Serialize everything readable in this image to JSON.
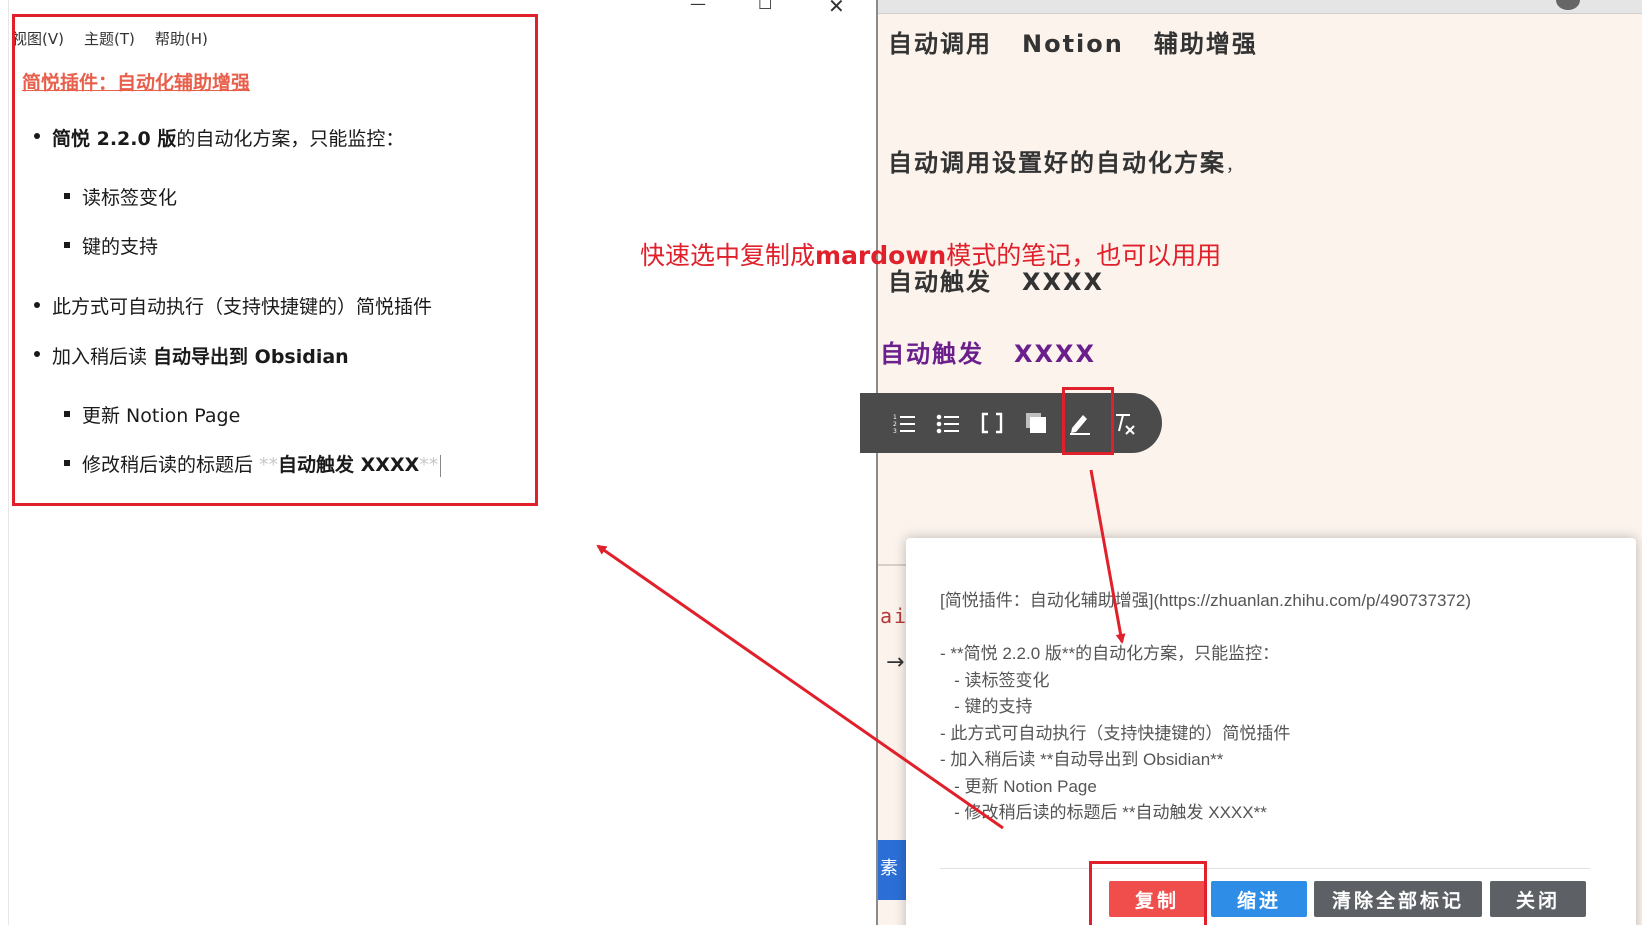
{
  "window": {
    "minimize_icon": "minimize-icon",
    "maximize_icon": "maximize-icon",
    "close_icon": "close-icon"
  },
  "menu": [
    "视图(V)",
    "主题(T)",
    "帮助(H)"
  ],
  "doc": {
    "title": "简悦插件：自动化辅助增强",
    "item1_bold": "简悦 2.2.0 版",
    "item1_rest": "的自动化方案，只能监控：",
    "sub1": "读标签变化",
    "sub2": "键的支持",
    "item2": "此方式可自动执行（支持快捷键的）简悦插件",
    "item3_pre": "加入稍后读 ",
    "item3_bold": "自动导出到 Obsidian",
    "sub3": "更新 Notion Page",
    "sub4_pre": "修改稍后读的标题后 ",
    "sub4_mark_open": "**",
    "sub4_bold": "自动触发 XXXX",
    "sub4_mark_close": "**"
  },
  "notion": {
    "h_auto_call": "自动调用",
    "h_notion": "Notion",
    "h_assist": "辅助增强",
    "h_preset": "自动调用设置好的自动化方案",
    "h_preset_comma": "，",
    "h_trigger_label": "自动触发",
    "h_trigger_value": "XXXX",
    "p_trigger_label": "自动触发",
    "p_trigger_value": "XXXX",
    "side_text": "ai.",
    "side_arrow": "→",
    "side_blue": "素"
  },
  "annotation": {
    "pre": "快速选中复制成",
    "bold": "mardown",
    "post": "模式的笔记，也可以用用"
  },
  "toolbar": {
    "icons": [
      "ordered-list-icon",
      "bullet-list-icon",
      "brackets-icon",
      "copy-icon",
      "highlight-pen-icon",
      "clear-format-icon"
    ]
  },
  "dialog": {
    "markdown": "[简悦插件：自动化辅助增强](https://zhuanlan.zhihu.com/p/490737372)\n\n- **简悦 2.2.0 版**的自动化方案，只能监控：\n   - 读标签变化\n   - 键的支持\n- 此方式可自动执行（支持快捷键的）简悦插件\n- 加入稍后读 **自动导出到 Obsidian**\n   - 更新 Notion Page\n   - 修改稍后读的标题后 **自动触发 XXXX**",
    "btn_copy": "复制",
    "btn_indent": "缩进",
    "btn_clear": "清除全部标记",
    "btn_close": "关闭"
  },
  "colors": {
    "annotation_red": "#e0202a",
    "title_orange": "#e8604c",
    "notion_bg": "#fbf3ec",
    "trigger_purple": "#6b1f8c",
    "btn_copy": "#f04d4d",
    "btn_indent": "#2e8de6",
    "btn_gray": "#5d6166"
  }
}
